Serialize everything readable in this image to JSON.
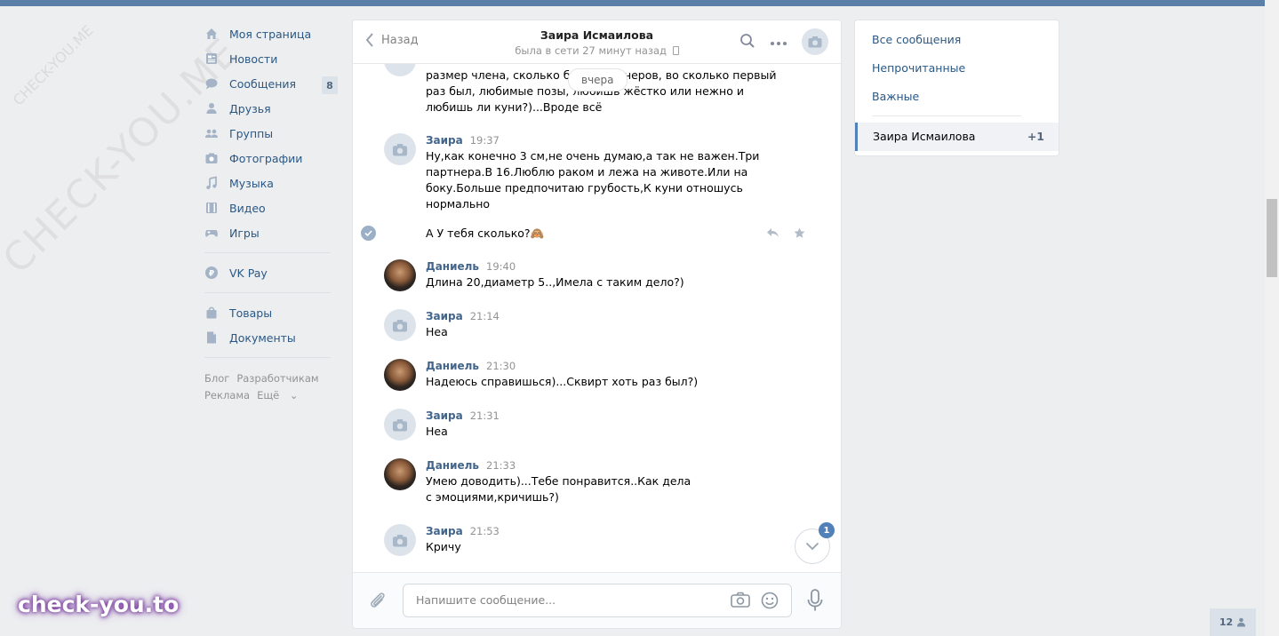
{
  "nav": {
    "items": [
      {
        "label": "Моя страница",
        "icon": "home-icon"
      },
      {
        "label": "Новости",
        "icon": "news-icon"
      },
      {
        "label": "Сообщения",
        "icon": "messages-icon",
        "badge": "8"
      },
      {
        "label": "Друзья",
        "icon": "friends-icon"
      },
      {
        "label": "Группы",
        "icon": "groups-icon"
      },
      {
        "label": "Фотографии",
        "icon": "photos-icon"
      },
      {
        "label": "Музыка",
        "icon": "music-icon"
      },
      {
        "label": "Видео",
        "icon": "video-icon"
      },
      {
        "label": "Игры",
        "icon": "games-icon"
      }
    ],
    "vkpay": "VK Pay",
    "goods": "Товары",
    "docs": "Документы",
    "footer": {
      "blog": "Блог",
      "dev": "Разработчикам",
      "ads": "Реклама",
      "more": "Ещё"
    }
  },
  "chat": {
    "back_label": "Назад",
    "title": "Заира Исмаилова",
    "status": "была в сети 27 минут назад",
    "day_label": "вчера",
    "partial_message": "размер члена, сколько было партнеров, во сколько первый раз был, любимые позы, любишь жёстко или нежно и любишь ли куни?)...Вроде всё",
    "messages": [
      {
        "author": "Заира",
        "time": "19:37",
        "text": "Ну,как конечно 3 см,не очень думаю,а так не важен.Три партнера.В 16.Люблю раком и лежа на животе.Или на боку.Больше предпочитаю грубость,К куни отношусь нормально"
      },
      {
        "author": "",
        "time": "",
        "text": "А У тебя сколько?🙈"
      },
      {
        "author": "Даниель",
        "time": "19:40",
        "text": "Длина 20,диаметр 5..,Имела с таким дело?)"
      },
      {
        "author": "Заира",
        "time": "21:14",
        "text": "Неа"
      },
      {
        "author": "Даниель",
        "time": "21:30",
        "text": "Надеюсь справишься)...Сквирт хоть раз был?)"
      },
      {
        "author": "Заира",
        "time": "21:31",
        "text": "Неа"
      },
      {
        "author": "Даниель",
        "time": "21:33",
        "text": "Умею доводить)...Тебе понравится..Как дела с эмоциями,кричишь?)"
      },
      {
        "author": "Заира",
        "time": "21:53",
        "text": "Кричу"
      }
    ],
    "unread_count": "1",
    "composer_placeholder": "Напишите сообщение..."
  },
  "filters": {
    "all": "Все сообщения",
    "unread": "Непрочитанные",
    "important": "Важные",
    "active_name": "Заира Исмаилова",
    "active_count": "+1"
  },
  "online_count": "12",
  "watermark": "CHECK-YOU.ME",
  "brand": "check-you.to",
  "colors": {
    "header_bar": "#5b7fa6",
    "link": "#2a5885",
    "accent": "#5181b8"
  }
}
